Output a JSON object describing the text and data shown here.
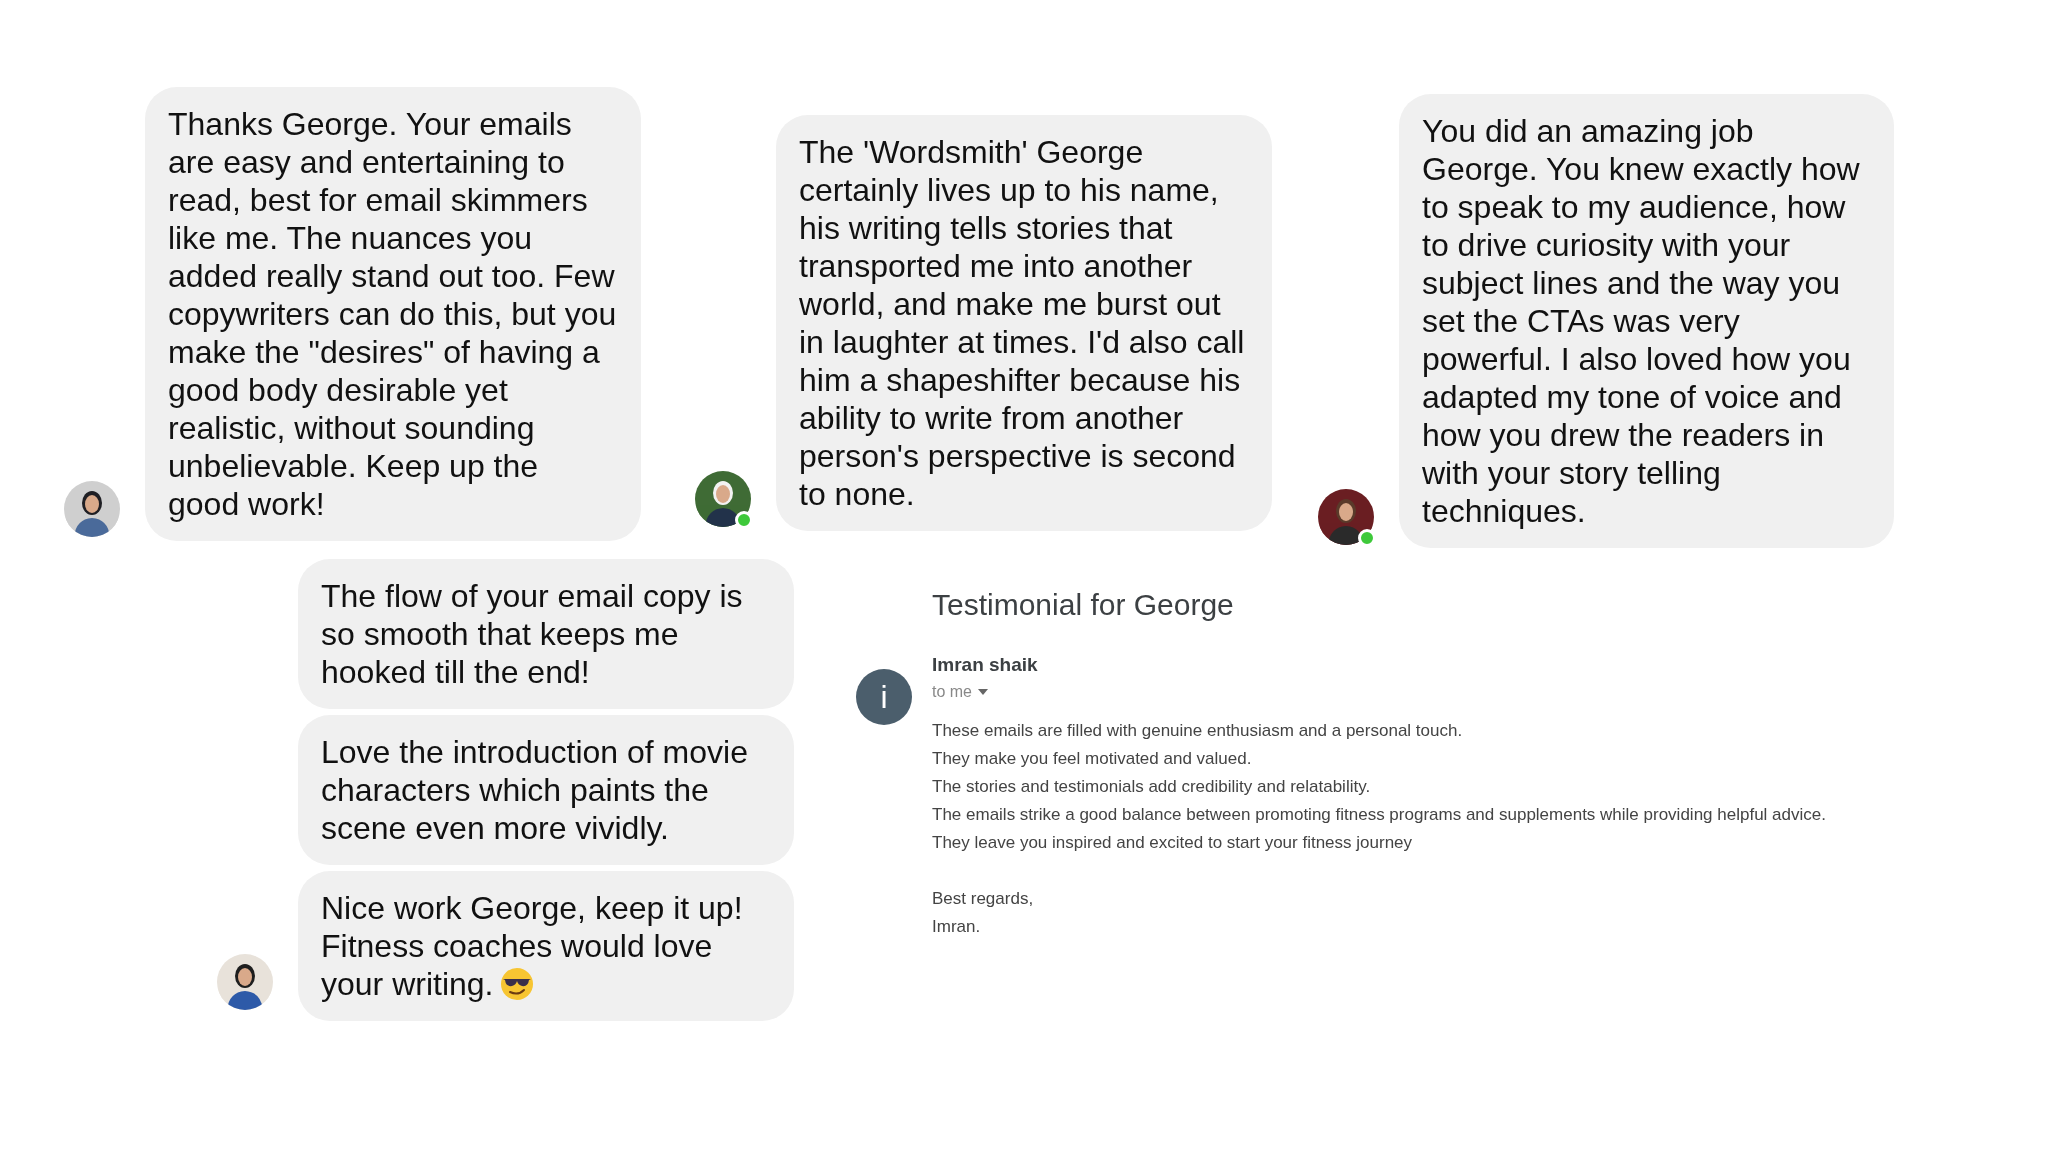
{
  "chats": [
    {
      "messages": [
        "Thanks George. Your emails are easy and entertaining to read, best for email skimmers like me. The nuances you added really stand out too. Few copywriters can do this, but you make the \"desires\" of having a good body desirable yet realistic, without sounding unbelievable. Keep up the good work!"
      ],
      "avatar": {
        "kind": "picture",
        "online": false
      }
    },
    {
      "messages": [
        "The 'Wordsmith' George certainly lives up to his name, his writing tells stories that transported me into another world, and make me burst out in laughter at times. I'd also call him a shapeshifter because his ability to write from another person's perspective is second to none."
      ],
      "avatar": {
        "kind": "picture",
        "online": true
      }
    },
    {
      "messages": [
        "You did an amazing job George. You knew exactly how to speak to my audience, how to drive curiosity with your subject lines and the way you set the CTAs was very powerful. I also loved how you adapted my tone of voice and how you drew the readers in with your story telling techniques."
      ],
      "avatar": {
        "kind": "picture",
        "online": true
      }
    },
    {
      "messages": [
        "The flow of your email copy is so smooth that keeps me hooked till the end!",
        "Love the introduction of movie characters which paints the scene even more vividly.",
        "Nice work George, keep it up! Fitness coaches would love your writing."
      ],
      "avatar": {
        "kind": "picture",
        "online": false
      }
    }
  ],
  "email": {
    "subject": "Testimonial for George",
    "sender_initial": "i",
    "sender": "Imran shaik",
    "recipient": "to me",
    "body": [
      "These emails are filled with genuine enthusiasm and a personal touch.",
      "They make you feel motivated and valued.",
      "The stories and testimonials add credibility and relatability.",
      "The emails strike a good balance between promoting fitness programs and supplements while providing helpful advice.",
      "They leave you inspired and excited to start your fitness journey"
    ],
    "signature": [
      "Best regards,",
      "Imran."
    ]
  }
}
